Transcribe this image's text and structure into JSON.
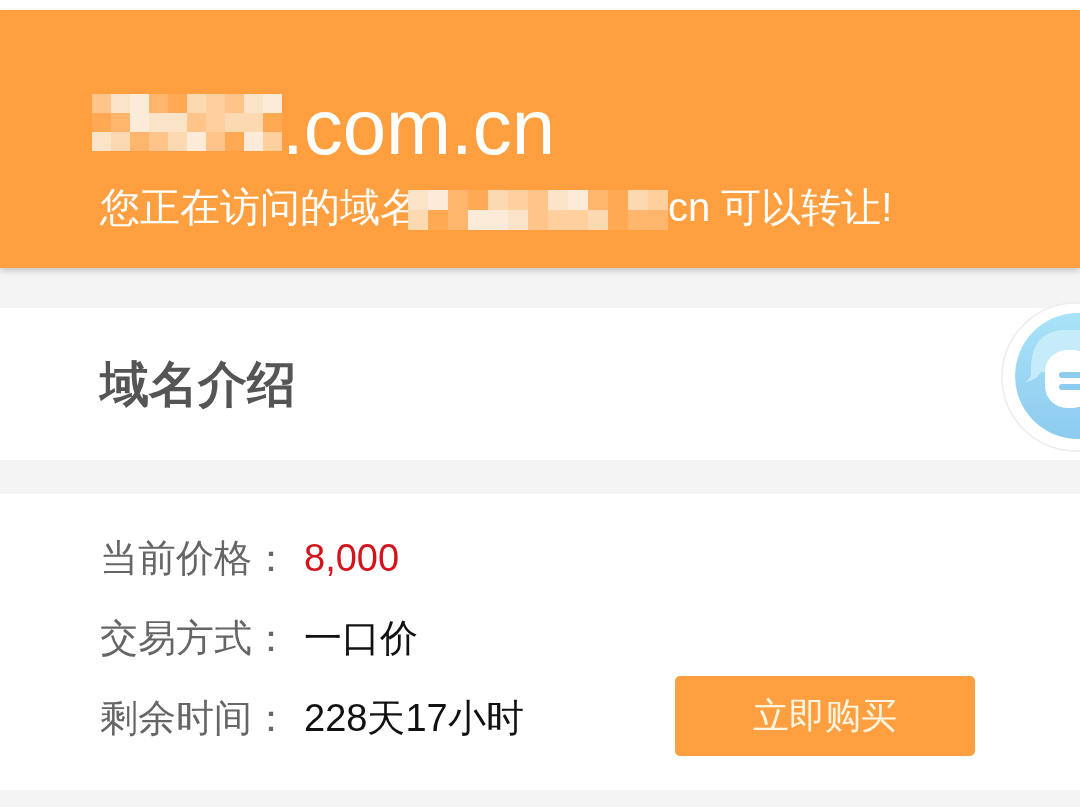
{
  "header": {
    "domain": ".com.cn",
    "notice_start": "您正在访问的域名",
    "notice_end": "cn 可以转让!"
  },
  "intro": {
    "title": "域名介绍"
  },
  "details": [
    {
      "label": "当前价格：",
      "value": "8,000",
      "kind": "price"
    },
    {
      "label": "交易方式：",
      "value": "一口价",
      "kind": "text"
    },
    {
      "label": "剩余时间：",
      "value": "228天17小时",
      "kind": "text"
    }
  ],
  "buy_button": {
    "label": "立即购买"
  }
}
